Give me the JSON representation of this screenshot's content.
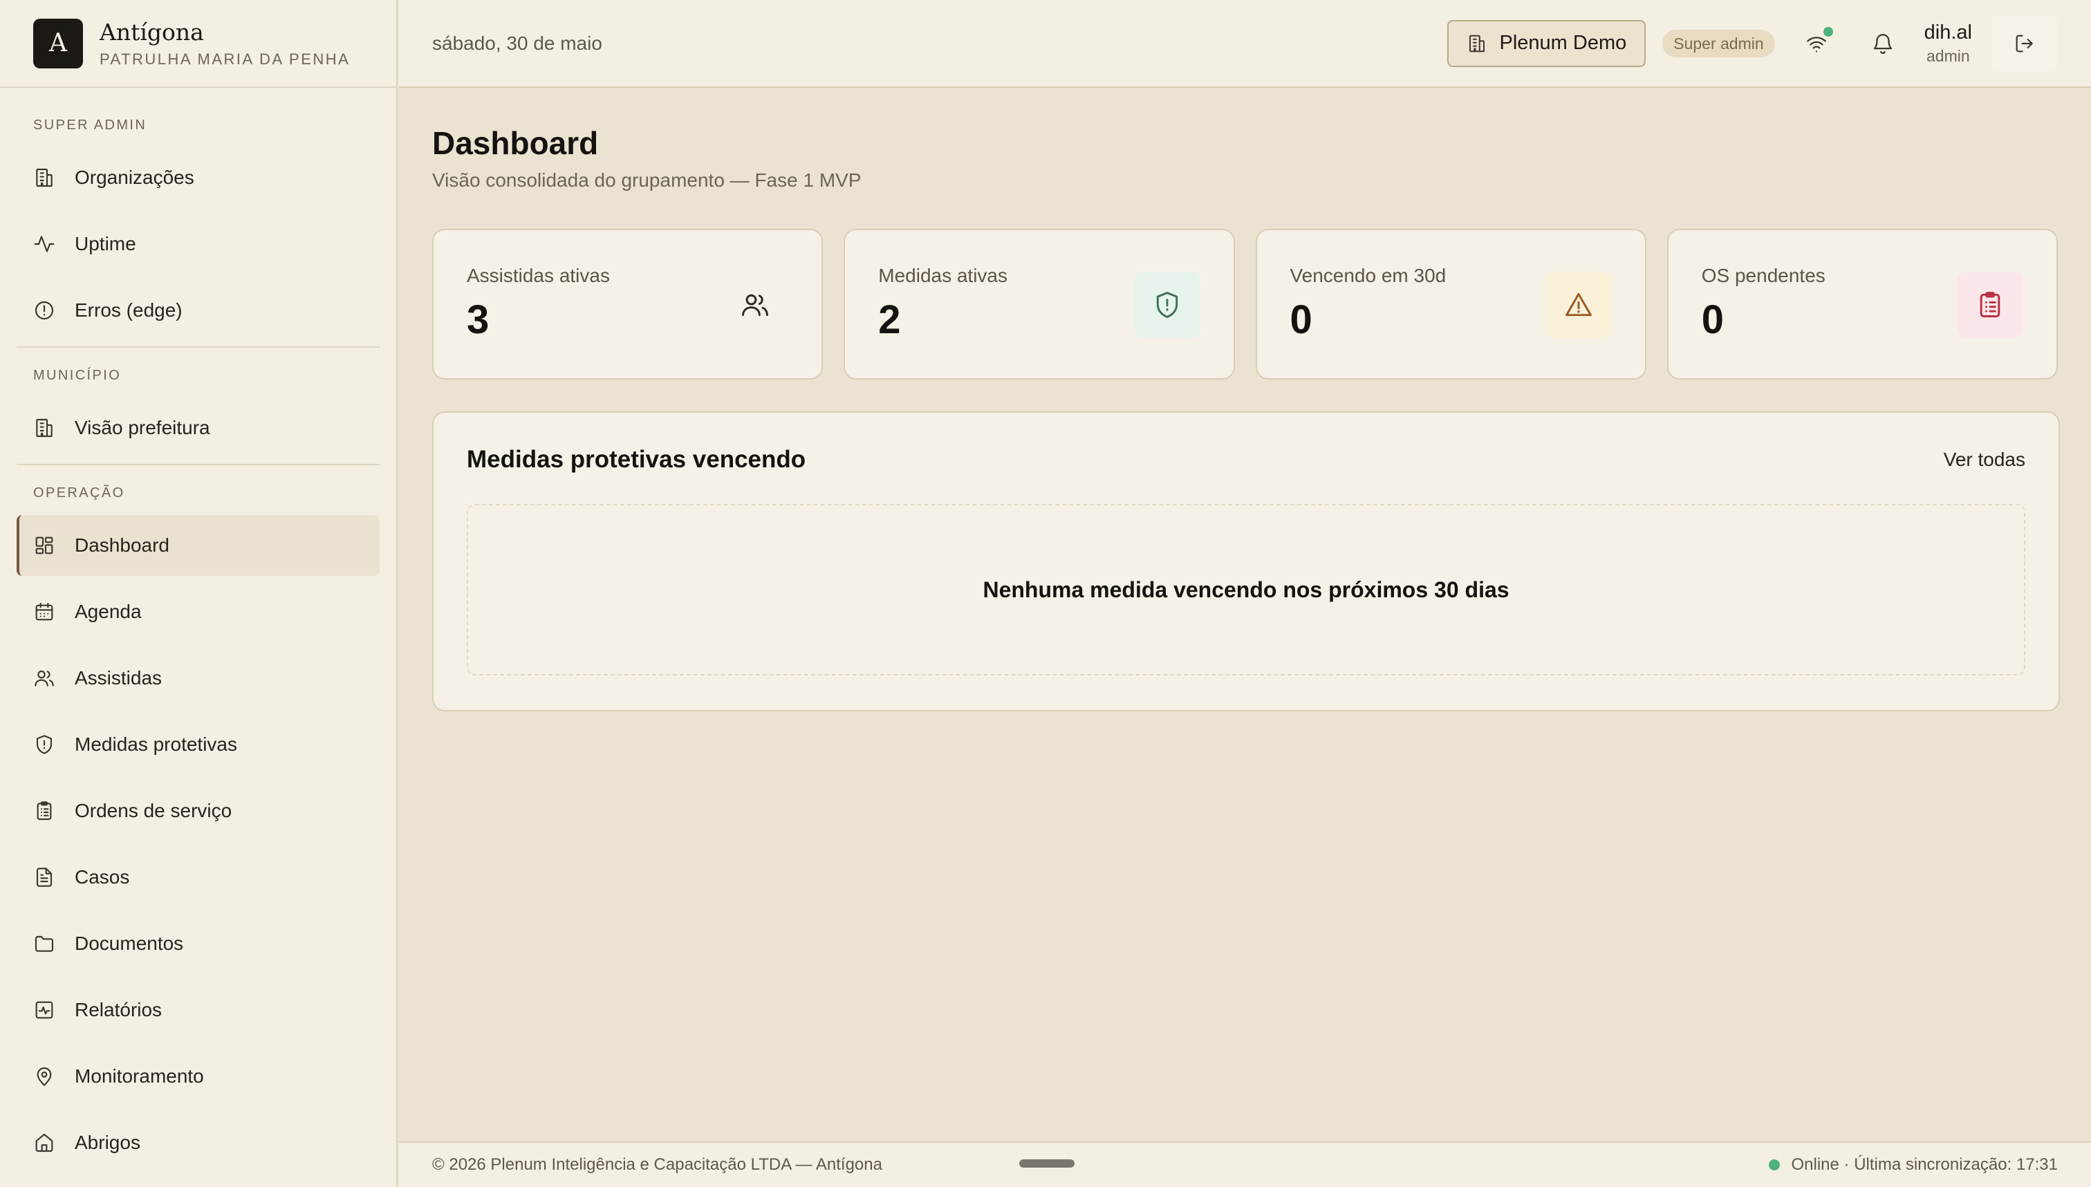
{
  "brand": {
    "logo_letter": "A",
    "name": "Antígona",
    "subtitle": "PATRULHA MARIA DA PENHA"
  },
  "sidebar": {
    "sections": [
      {
        "title": "SUPER ADMIN",
        "items": [
          {
            "label": "Organizações",
            "icon": "building-icon"
          },
          {
            "label": "Uptime",
            "icon": "activity-icon"
          },
          {
            "label": "Erros (edge)",
            "icon": "alert-circle-icon"
          }
        ]
      },
      {
        "title": "MUNICÍPIO",
        "items": [
          {
            "label": "Visão prefeitura",
            "icon": "building-icon"
          }
        ]
      },
      {
        "title": "OPERAÇÃO",
        "items": [
          {
            "label": "Dashboard",
            "icon": "dashboard-icon",
            "active": true
          },
          {
            "label": "Agenda",
            "icon": "calendar-icon"
          },
          {
            "label": "Assistidas",
            "icon": "users-icon"
          },
          {
            "label": "Medidas protetivas",
            "icon": "shield-alert-icon"
          },
          {
            "label": "Ordens de serviço",
            "icon": "clipboard-icon"
          },
          {
            "label": "Casos",
            "icon": "file-text-icon"
          },
          {
            "label": "Documentos",
            "icon": "folder-icon"
          },
          {
            "label": "Relatórios",
            "icon": "chart-icon"
          },
          {
            "label": "Monitoramento",
            "icon": "map-pin-icon"
          },
          {
            "label": "Abrigos",
            "icon": "home-icon"
          }
        ]
      }
    ]
  },
  "topbar": {
    "date": "sábado, 30 de maio",
    "org_button": "Plenum Demo",
    "role_badge": "Super admin",
    "user_name": "dih.al",
    "user_role": "admin"
  },
  "main": {
    "title": "Dashboard",
    "subtitle": "Visão consolidada do grupamento — Fase 1 MVP",
    "stats": [
      {
        "label": "Assistidas ativas",
        "value": "3",
        "icon": "users-icon",
        "tone": "plain"
      },
      {
        "label": "Medidas ativas",
        "value": "2",
        "icon": "shield-alert-icon",
        "tone": "green"
      },
      {
        "label": "Vencendo em 30d",
        "value": "0",
        "icon": "warning-triangle-icon",
        "tone": "amber"
      },
      {
        "label": "OS pendentes",
        "value": "0",
        "icon": "clipboard-icon",
        "tone": "rose"
      }
    ],
    "panel": {
      "title": "Medidas protetivas vencendo",
      "link": "Ver todas",
      "empty": "Nenhuma medida vencendo nos próximos 30 dias"
    }
  },
  "footer": {
    "copyright": "© 2026 Plenum Inteligência e Capacitação LTDA — Antígona",
    "sync": "Online · Última sincronização: 17:31"
  },
  "colors": {
    "accent": "#7a5a3d",
    "online": "#4fb27d",
    "background": "#ebe3d2",
    "surface": "#f4efe3"
  }
}
